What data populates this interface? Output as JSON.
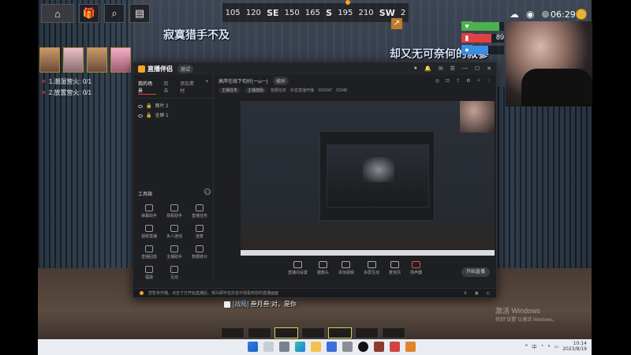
{
  "hud": {
    "top_icons": [
      "home-icon",
      "gift-icon",
      "search-icon",
      "book-icon"
    ],
    "compass": [
      "105",
      "120",
      "SE",
      "150",
      "165",
      "S",
      "195",
      "210",
      "SW",
      "2"
    ],
    "clock": "06:29"
  },
  "captions": {
    "line1": "寂寞猎手不及",
    "line2": "却又无可奈何的寂寥"
  },
  "quests": [
    "1.潮湿营火: 0/1",
    "2.放置营火: 0/1"
  ],
  "stats": [
    {
      "icon": "heart-icon",
      "value": "",
      "color": "#4caf50",
      "fill": 0.85
    },
    {
      "icon": "food-icon",
      "value": "89",
      "color": "#e04040",
      "fill": 0.6
    },
    {
      "icon": "water-icon",
      "value": "",
      "color": "#3a8ee6",
      "fill": 0.5
    }
  ],
  "app": {
    "title": "直播伴侣",
    "badge": "测试",
    "tabs": [
      "我的场景",
      "双击",
      "添加素材"
    ],
    "scenes": [
      "图片 2",
      "全屏 1"
    ],
    "toolbox_title": "工具箱",
    "tools": [
      "弹幕助手",
      "观看助手",
      "直播任务",
      "视频直播",
      "多人连线",
      "连麦",
      "直播回放",
      "主播助手",
      "数据统计",
      "福袋",
      "互动"
    ],
    "toolbar_text": "高岸在线下旬好(一ω一)",
    "toolbar_pill": "横屏",
    "subbar_items": [
      "主播任务",
      "主播激励",
      "拓展任务",
      "抖音直播开播",
      "3/15047",
      "52348"
    ],
    "controls": [
      "直播间设置",
      "摄像头",
      "添加视频",
      "多屏互动",
      "麦克风",
      "扬声器"
    ],
    "start_label": "开始直播",
    "status_text": "您暂未开播，点击下方开始直播后，观众即可在抖音中观看到您的直播画面"
  },
  "chat": {
    "tag": "[战局]",
    "text": "叁月叁:对，是你"
  },
  "activate_windows": {
    "title": "激活 Windows",
    "subtitle": "转到\"设置\"以激活 Windows。"
  },
  "taskbar": {
    "time": "10:14",
    "date": "2023/8/19"
  }
}
